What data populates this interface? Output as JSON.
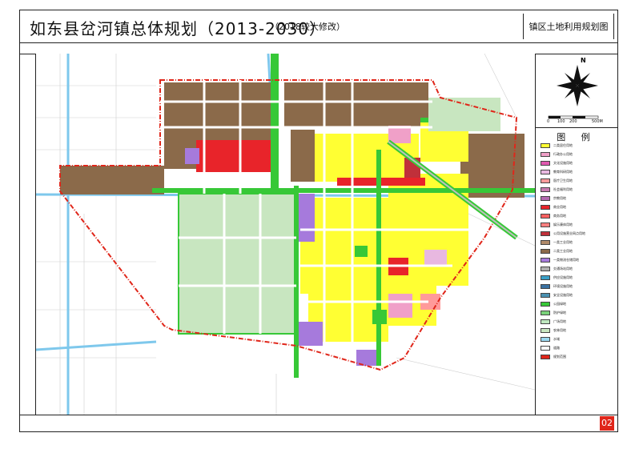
{
  "header": {
    "title": "如东县岔河镇总体规划（2013-2030）",
    "subtitle": "（2018较大修改）",
    "plan_name": "镇区土地利用规划图"
  },
  "compass": {
    "north_label": "N",
    "scale_labels": [
      "0",
      "100",
      "200",
      "500M"
    ]
  },
  "legend": {
    "title": "图  例",
    "items": [
      {
        "label": "二类居住用地",
        "color": "#ffff33"
      },
      {
        "label": "行政办公用地",
        "color": "#f0a0c8"
      },
      {
        "label": "文化设施用地",
        "color": "#e05ab0"
      },
      {
        "label": "教育科研用地",
        "color": "#e8b8e0"
      },
      {
        "label": "医疗卫生用地",
        "color": "#ff9a9a"
      },
      {
        "label": "社会福利用地",
        "color": "#c87ab0"
      },
      {
        "label": "宗教用地",
        "color": "#b36ab0"
      },
      {
        "label": "商业用地",
        "color": "#e8242a"
      },
      {
        "label": "商务用地",
        "color": "#ff6060"
      },
      {
        "label": "娱乐康体用地",
        "color": "#ff8080"
      },
      {
        "label": "公用设施营业网点用地",
        "color": "#c0303a"
      },
      {
        "label": "一类工业用地",
        "color": "#b08a6a"
      },
      {
        "label": "二类工业用地",
        "color": "#8b6a4a"
      },
      {
        "label": "一类物流仓储用地",
        "color": "#a67adc"
      },
      {
        "label": "交通场站用地",
        "color": "#b0b0b0"
      },
      {
        "label": "供应设施用地",
        "color": "#3aa0c8"
      },
      {
        "label": "环境设施用地",
        "color": "#3a70a0"
      },
      {
        "label": "安全设施用地",
        "color": "#4a90b0"
      },
      {
        "label": "公园绿地",
        "color": "#37c837"
      },
      {
        "label": "防护绿地",
        "color": "#7ad17a"
      },
      {
        "label": "广场用地",
        "color": "#bfe8bf"
      },
      {
        "label": "农林用地",
        "color": "#c8e6c0"
      },
      {
        "label": "水域",
        "color": "#9ad8f0"
      },
      {
        "label": "道路",
        "color": "#ffffff"
      },
      {
        "label": "规划范围",
        "color": "#e0261a"
      }
    ]
  },
  "footer": {
    "sheet_number": "02"
  }
}
